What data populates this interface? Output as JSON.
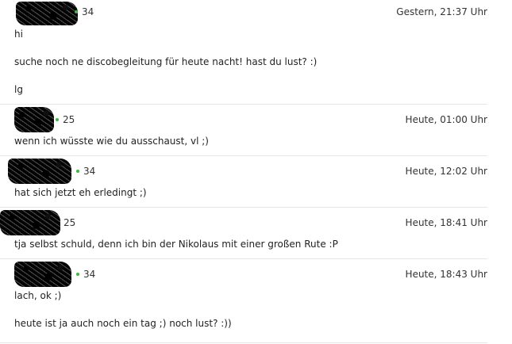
{
  "messages": [
    {
      "age": "34",
      "online": true,
      "time": "Gestern, 21:37 Uhr",
      "lines": [
        "hi",
        "",
        "suche noch ne discobegleitung für heute nacht! hast du lust? :)",
        "",
        "lg"
      ]
    },
    {
      "age": "25",
      "online": true,
      "time": "Heute, 01:00 Uhr",
      "lines": [
        "wenn ich wüsste wie du ausschaust, vl ;)"
      ]
    },
    {
      "age": "34",
      "online": true,
      "time": "Heute, 12:02 Uhr",
      "lines": [
        "hat sich jetzt eh erledingt ;)"
      ]
    },
    {
      "age": "25",
      "online": false,
      "time": "Heute, 18:41 Uhr",
      "lines": [
        "tja selbst schuld, denn ich bin der Nikolaus mit einer großen Rute :P"
      ]
    },
    {
      "age": "34",
      "online": true,
      "time": "Heute, 18:43 Uhr",
      "lines": [
        "lach, ok ;)",
        "",
        "heute ist ja auch noch ein tag ;) noch lust? :))"
      ]
    }
  ]
}
